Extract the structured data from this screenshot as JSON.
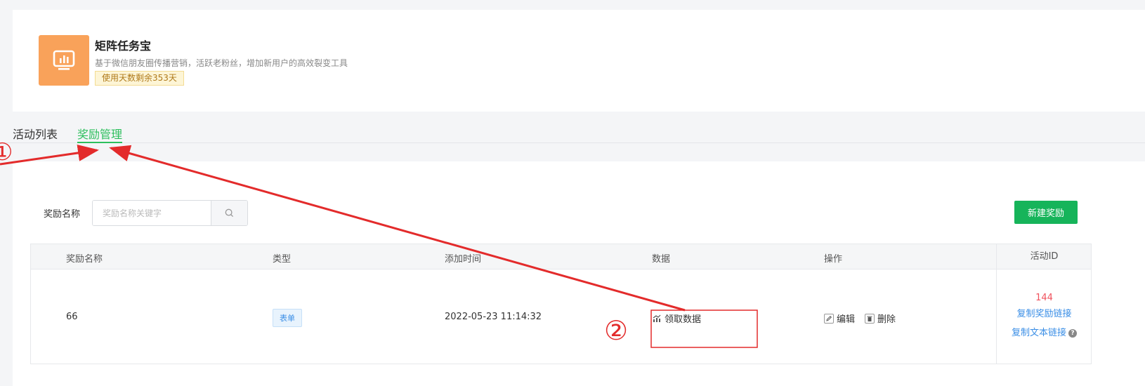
{
  "app": {
    "title": "矩阵任务宝",
    "description": "基于微信朋友圈传播营销，活跃老粉丝，增加新用户的高效裂变工具",
    "remaining": "使用天数剩余353天",
    "logo_icon": "bar-chart-board-icon",
    "logo_color": "#f9a25a"
  },
  "tabs": [
    {
      "label": "活动列表",
      "active": false
    },
    {
      "label": "奖励管理",
      "active": true
    }
  ],
  "toolbar": {
    "search_label": "奖励名称",
    "search_placeholder": "奖励名称关键字",
    "search_icon": "search-icon",
    "new_button": "新建奖励"
  },
  "table": {
    "columns": [
      "奖励名称",
      "类型",
      "添加时间",
      "数据",
      "操作",
      "活动ID"
    ],
    "rows": [
      {
        "name": "66",
        "type": "表单",
        "added_time": "2022-05-23 11:14:32",
        "data_link": "领取数据",
        "edit": "编辑",
        "delete": "删除",
        "activity_id": "144",
        "copy_reward_link": "复制奖励链接",
        "copy_text_link": "复制文本链接"
      }
    ]
  },
  "annotations": {
    "marker_1": "①",
    "marker_2": "②",
    "color": "#e32b2b"
  },
  "colors": {
    "accent_green": "#16b45a",
    "tab_green": "#2dbf5d",
    "link_blue": "#3a8ee6",
    "id_red": "#f0525d"
  }
}
